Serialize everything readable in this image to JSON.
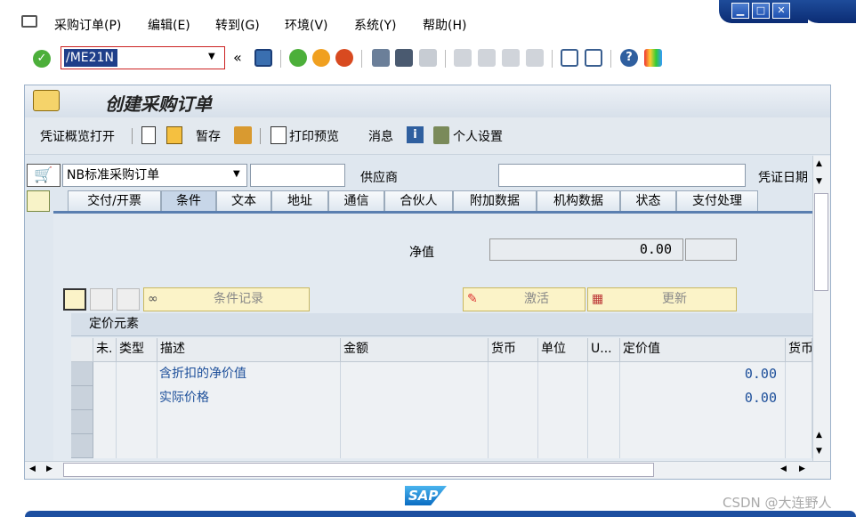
{
  "menubar": {
    "items": [
      "采购订单(P)",
      "编辑(E)",
      "转到(G)",
      "环境(V)",
      "系统(Y)",
      "帮助(H)"
    ],
    "window_controls": [
      "minimize",
      "maximize",
      "close"
    ]
  },
  "toolbar": {
    "command_field": "/ME21N",
    "chevron": "«"
  },
  "screen": {
    "title": "创建采购订单",
    "app_toolbar": {
      "overview": "凭证概览打开",
      "hold": "暂存",
      "print_preview": "打印预览",
      "messages": "消息",
      "personal_settings": "个人设置"
    }
  },
  "header": {
    "doc_type": "NB标准采购订单",
    "vendor_label": "供应商",
    "doc_date_label": "凭证日期"
  },
  "tabs": [
    "交付/开票",
    "条件",
    "文本",
    "地址",
    "通信",
    "合伙人",
    "附加数据",
    "机构数据",
    "状态",
    "支付处理"
  ],
  "active_tab": "条件",
  "conditions": {
    "net_value_label": "净值",
    "net_value": "0.00",
    "buttons": {
      "condition_record": "条件记录",
      "activate": "激活",
      "update": "更新"
    },
    "section_title": "定价元素",
    "columns": [
      "未.",
      "类型",
      "描述",
      "金额",
      "货币",
      "单位",
      "U...",
      "定价值",
      "货币"
    ],
    "rows": [
      {
        "description": "含折扣的净价值",
        "pricing_value": "0.00"
      },
      {
        "description": "实际价格",
        "pricing_value": "0.00"
      }
    ]
  },
  "footer": {
    "logo": "SAP",
    "watermark": "CSDN @大连野人"
  },
  "colors": {
    "window_blue": "#1e4c9a",
    "frame_bg": "#dfe7ef",
    "button_yellow": "#fbf3c8",
    "value_blue": "#1d4f9a"
  }
}
